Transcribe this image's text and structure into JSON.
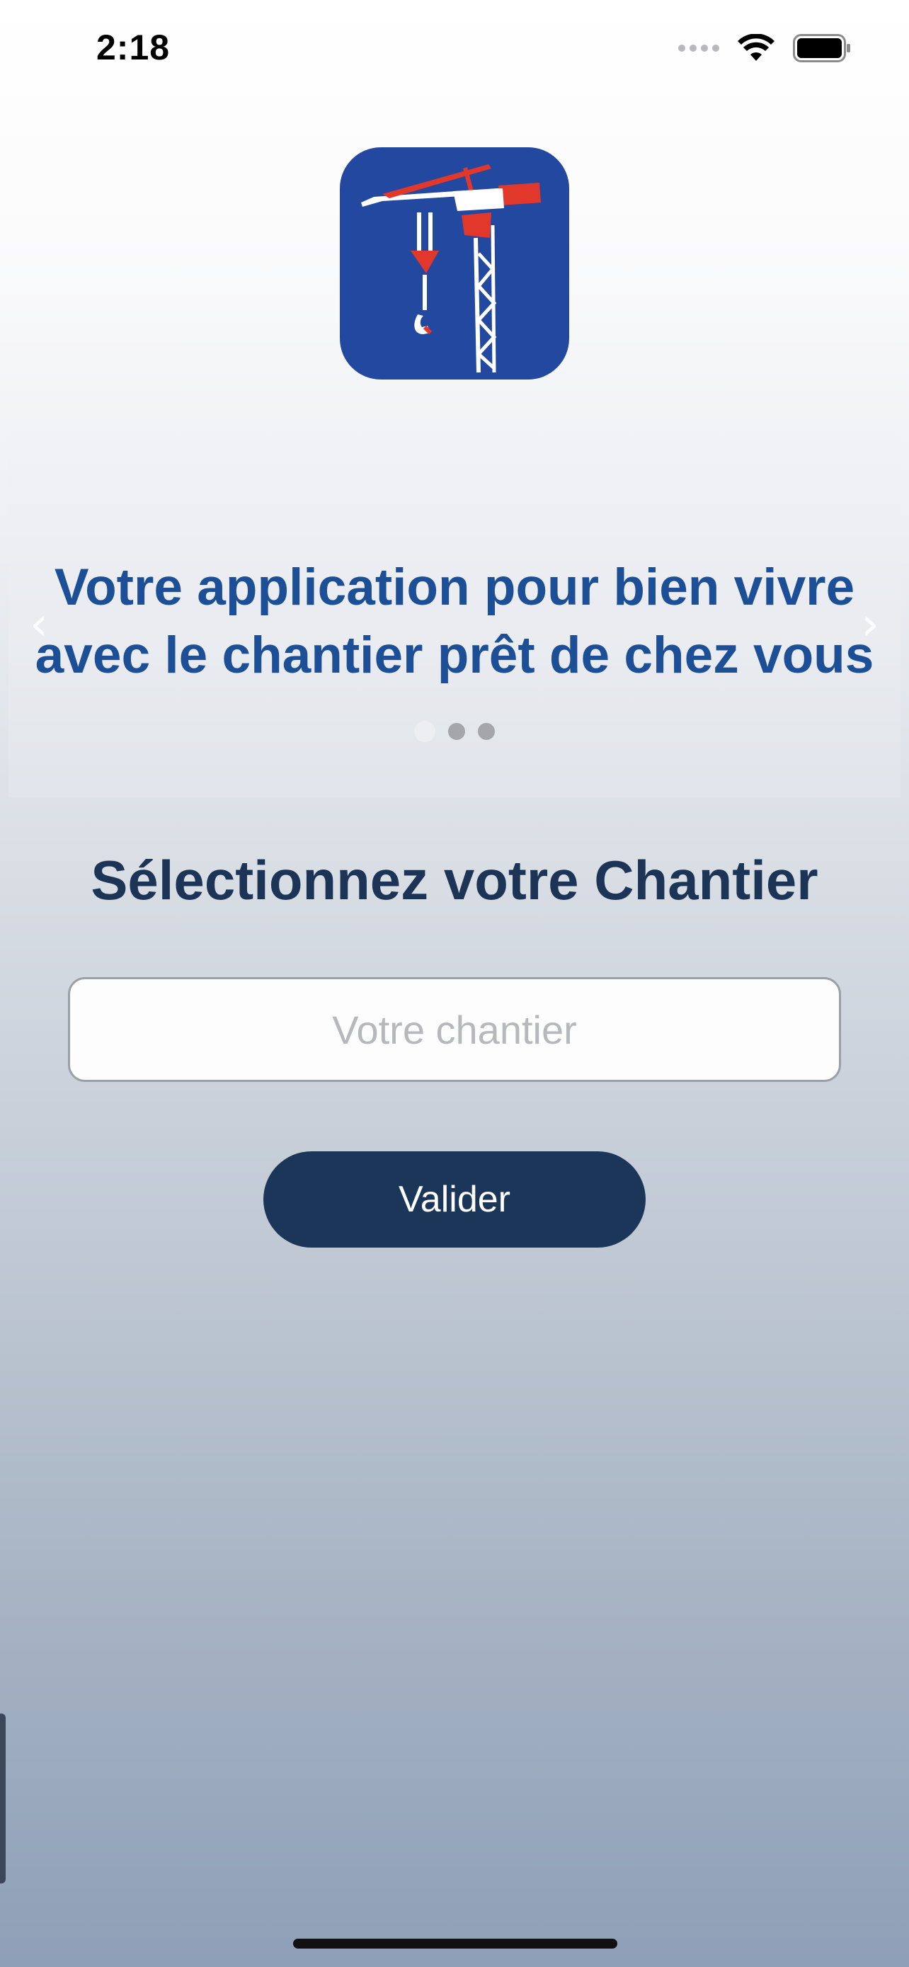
{
  "status_bar": {
    "time": "2:18",
    "icons": [
      "cellular-signal-icon",
      "wifi-icon",
      "battery-icon"
    ]
  },
  "carousel": {
    "slides": [
      {
        "line1": "Votre application pour bien vivre",
        "line2": "avec le chantier prêt de chez vous"
      }
    ],
    "active_index": 0,
    "dot_count": 3
  },
  "main": {
    "title": "Sélectionnez votre Chantier",
    "input": {
      "placeholder": "Votre chantier",
      "value": ""
    },
    "submit_label": "Valider"
  },
  "colors": {
    "logo_blue": "#2348a0",
    "accent_red": "#e2382b",
    "title_navy": "#1c3557",
    "slide_blue": "#1d4f96",
    "button_navy": "#1c365a"
  }
}
